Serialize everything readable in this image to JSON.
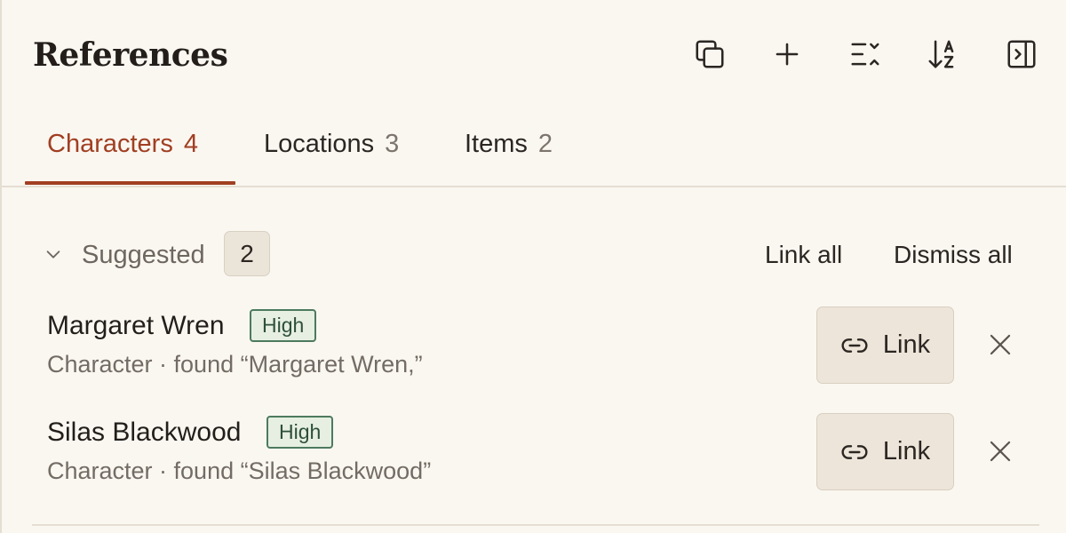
{
  "header": {
    "title": "References"
  },
  "toolbar": {
    "buttons": [
      {
        "name": "copy-icon"
      },
      {
        "name": "plus-icon"
      },
      {
        "name": "expand-collapse-icon"
      },
      {
        "name": "sort-az-icon"
      },
      {
        "name": "collapse-panel-icon"
      }
    ]
  },
  "tabs": [
    {
      "label": "Characters",
      "count": "4",
      "active": true
    },
    {
      "label": "Locations",
      "count": "3",
      "active": false
    },
    {
      "label": "Items",
      "count": "2",
      "active": false
    }
  ],
  "suggested": {
    "label": "Suggested",
    "count": "2",
    "collapse_icon": "chevron-down-icon",
    "link_all_label": "Link all",
    "dismiss_all_label": "Dismiss all",
    "items": [
      {
        "name": "Margaret Wren",
        "confidence": "High",
        "subtitle": "Character · found “Margaret Wren,”",
        "link_label": "Link",
        "link_icon": "link-icon",
        "dismiss_icon": "close-icon"
      },
      {
        "name": "Silas Blackwood",
        "confidence": "High",
        "subtitle": "Character · found “Silas Blackwood”",
        "link_label": "Link",
        "link_icon": "link-icon",
        "dismiss_icon": "close-icon"
      }
    ]
  },
  "colors": {
    "background": "#faf7f1",
    "accent": "#a13f22",
    "confidence_border": "#4d7a5e",
    "confidence_bg": "#e6efe2",
    "button_bg": "#ede5d9"
  }
}
